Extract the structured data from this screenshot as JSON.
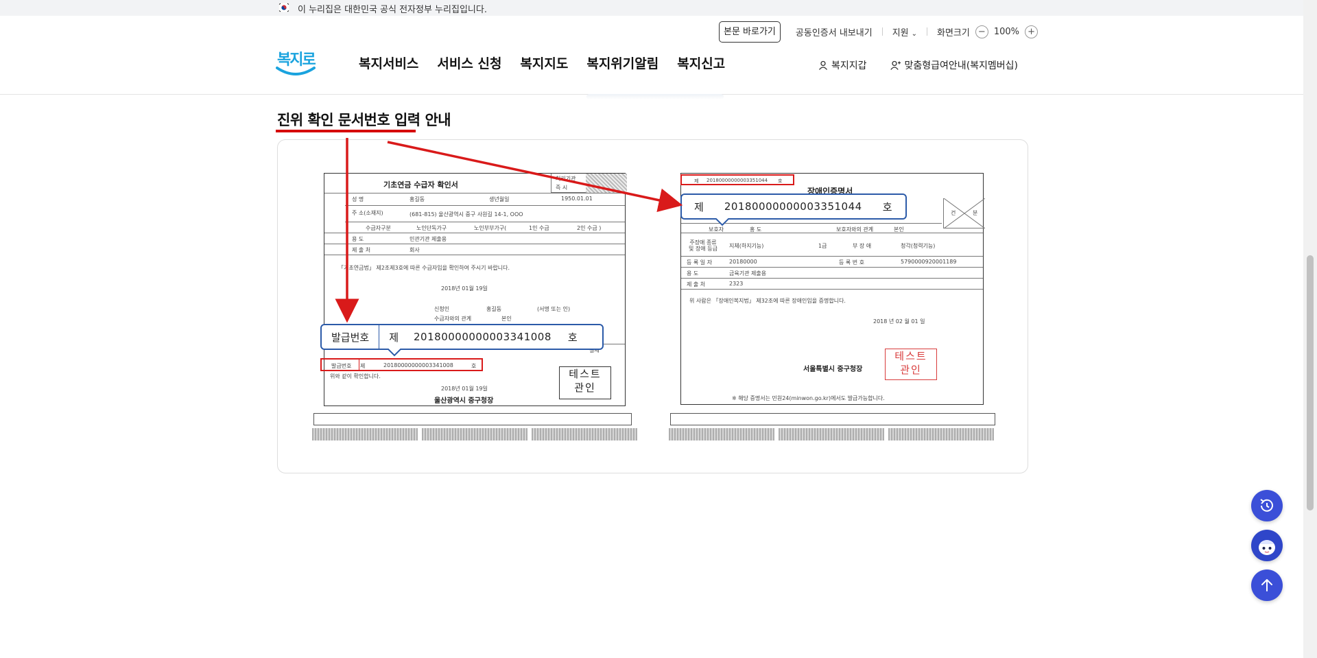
{
  "gov_banner": {
    "text": "이 누리집은 대한민국 공식 전자정부 누리집입니다."
  },
  "utility": {
    "skip_link": "본문 바로가기",
    "cert_export": "공동인증서 내보내기",
    "support": "지원",
    "zoom_label": "화면크기",
    "zoom_minus": "−",
    "zoom_value": "100%",
    "zoom_plus": "+"
  },
  "logo": {
    "text": "복지로"
  },
  "gnb": [
    "복지서비스",
    "서비스 신청",
    "복지지도",
    "복지위기알림",
    "복지신고"
  ],
  "right_nav": {
    "wallet": "복지지갑",
    "membership": "맞춤형급여안내(복지멤버십)"
  },
  "content": {
    "title": "진위 확인 문서번호 입력 안내"
  },
  "doc_left": {
    "title": "기초연금 수급자 확인서",
    "corner_top": "처리기관",
    "corner_bottom": "즉 시",
    "row_labels": [
      "성 명",
      "생년월일",
      "주 소(소재지)",
      "수급자구분",
      "용 도",
      "제 출 처"
    ],
    "name_value": "홍길동",
    "birth_value": "1950.01.01",
    "address_value": "(681-815) 울산광역시 중구 사원길 14-1, OOO",
    "type_options": [
      "노인단독가구",
      "노인부부가구(",
      "1인 수급",
      "2인 수급 )"
    ],
    "purpose_value": "민관기관 제출용",
    "submit_value": "회사",
    "statement": "「기초연금법」 제2조제3호에 따른 수급자임을 확인하여 주시기 바랍니다.",
    "date1": "2018년 01월 19일",
    "applicant": "신청인",
    "applicant_name": "홍길동",
    "sign": "(서명 또는 인)",
    "relation": "수급자와의 관계",
    "relation_value": "본인",
    "issue_label_small": "발급번호",
    "issue_prefix_small": "제",
    "issue_number_small": "20180000000003341008",
    "issue_suffix_small": "호",
    "confirm_text": "위와 같이 확인합니다.",
    "date2": "2018년 01월 19일",
    "issuer": "울산광역시 중구청장",
    "stamp": [
      "테스트",
      "관인"
    ],
    "side_label": "결제"
  },
  "callout_left": {
    "label": "발급번호",
    "prefix": "제",
    "number": "20180000000003341008",
    "suffix": "호"
  },
  "doc_right": {
    "title": "장애인증명서",
    "top_number_prefix": "제",
    "top_number": "20180000000003351044",
    "top_number_suffix": "호",
    "corner_left": "건",
    "corner_right": "분",
    "rows": [
      {
        "label": "보호자",
        "value": "홍 도",
        "label2": "보호자와의 관계",
        "value2": "본인"
      },
      {
        "label": "주장애 종류 및 장애 등급",
        "value": "지체(하지기능)",
        "mid": "1급",
        "label2": "부 장 애",
        "value2": "청각(청력기능)"
      },
      {
        "label": "등 록 일 자",
        "value": "20180000",
        "label2": "등 록 번 호",
        "value2": "5790000920001189"
      },
      {
        "label": "용 도",
        "value": "금육기관 제출용"
      },
      {
        "label": "제 출 처",
        "value": "2323"
      }
    ],
    "statement": "위 사람은 「장애인복지법」 제32조에 따른 장애인임을 증명합니다.",
    "date": "2018 년 02 월 01 일",
    "issuer": "서울특별시 중구청장",
    "stamp": [
      "테스트",
      "관인"
    ],
    "footer": "※ 해당 증명서는 민원24(minwon.go.kr)에서도 발급가능합니다."
  },
  "callout_right": {
    "prefix": "제",
    "number": "20180000000003351044",
    "suffix": "호"
  },
  "floating": [
    "history-button",
    "chatbot-button",
    "scroll-top-button"
  ]
}
